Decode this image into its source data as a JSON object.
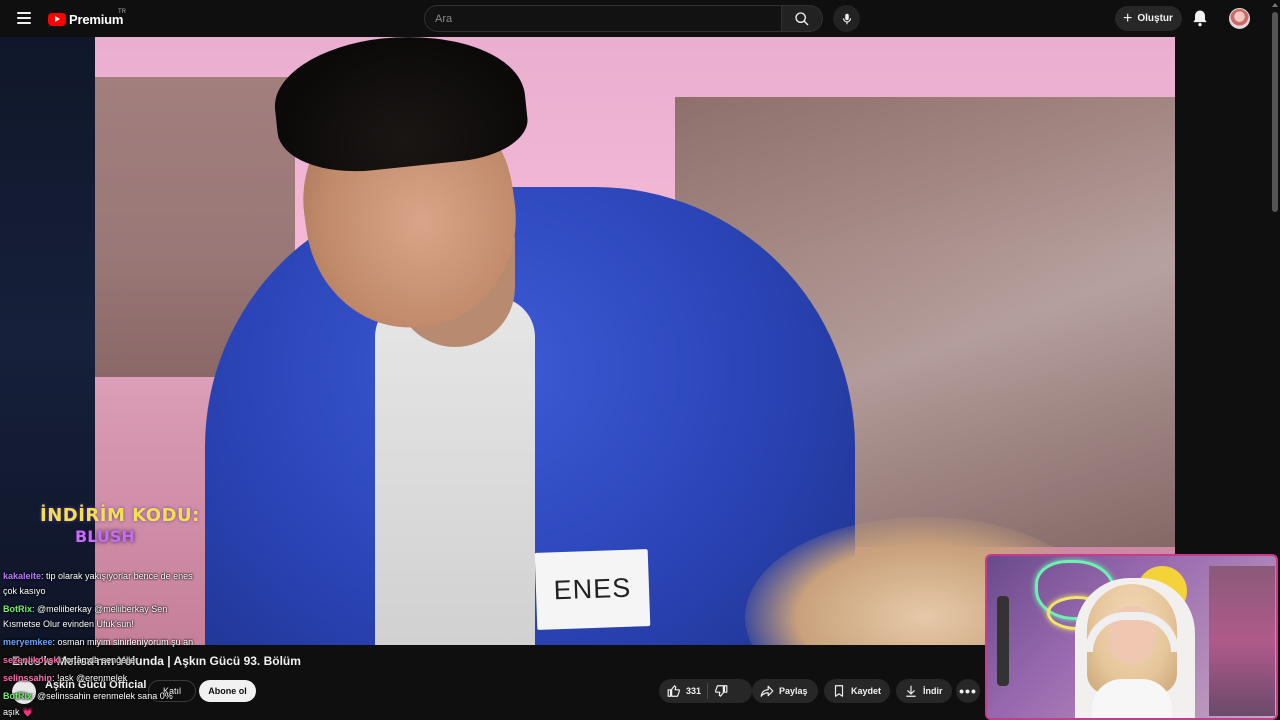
{
  "header": {
    "logo_text": "Premium",
    "region": "TR",
    "search_placeholder": "Ara",
    "create_label": "Oluştur"
  },
  "overlay": {
    "promo_line1": "İNDİRİM KODU:",
    "promo_line2": "BLUSH"
  },
  "chat": [
    {
      "user": "kakaleite",
      "user_color": "#b57bff",
      "text": ": tip olarak yakışıyorlar bence de enes"
    },
    {
      "user": "",
      "user_color": "#ffffff",
      "text": "çok kasıyo"
    },
    {
      "user": "BotRix",
      "user_color": "#6ef06e",
      "text": ": @meliiberkay @meliiberkay Sen"
    },
    {
      "user": "",
      "user_color": "#ffffff",
      "text": "Kısmetse Olur evinden Ufuk'sun!"
    },
    {
      "user": "meryemkee",
      "user_color": "#6aa0ff",
      "text": ": osman miyim sinirleniyorum şu an"
    },
    {
      "user": "sezenlikovski",
      "user_color": "#ff6ab0",
      "text": ": ortamda sengeller"
    },
    {
      "user": "selinssahin",
      "user_color": "#ff6ab0",
      "text": ": !aşk @erenmelek"
    },
    {
      "user": "BotRix",
      "user_color": "#6ef06e",
      "text": ": @selinssahin erenmelek sana 0%"
    },
    {
      "user": "",
      "user_color": "#ffffff",
      "text": "aşık 💗"
    }
  ],
  "video": {
    "name_badge": "ENES",
    "title": "Enes'le Melisa'nın Yolunda | Aşkın Gücü 93. Bölüm",
    "channel": "Aşkın Gücü Official",
    "join_label": "Katıl",
    "subscribe_label": "Abone ol",
    "likes": "331",
    "share_label": "Paylaş",
    "save_label": "Kaydet",
    "download_label": "İndir",
    "more_label": "•••"
  },
  "colors": {
    "background": "#0f0f0f",
    "brand_red": "#ff0000",
    "cam_border": "#c83b8c",
    "promo_yellow": "#f4e04a",
    "promo_purple": "#c56cf0"
  },
  "icons": [
    "menu-icon",
    "youtube-logo-icon",
    "search-icon",
    "mic-icon",
    "plus-icon",
    "bell-icon",
    "avatar",
    "like-icon",
    "dislike-icon",
    "share-icon",
    "save-icon",
    "download-icon",
    "more-icon"
  ]
}
